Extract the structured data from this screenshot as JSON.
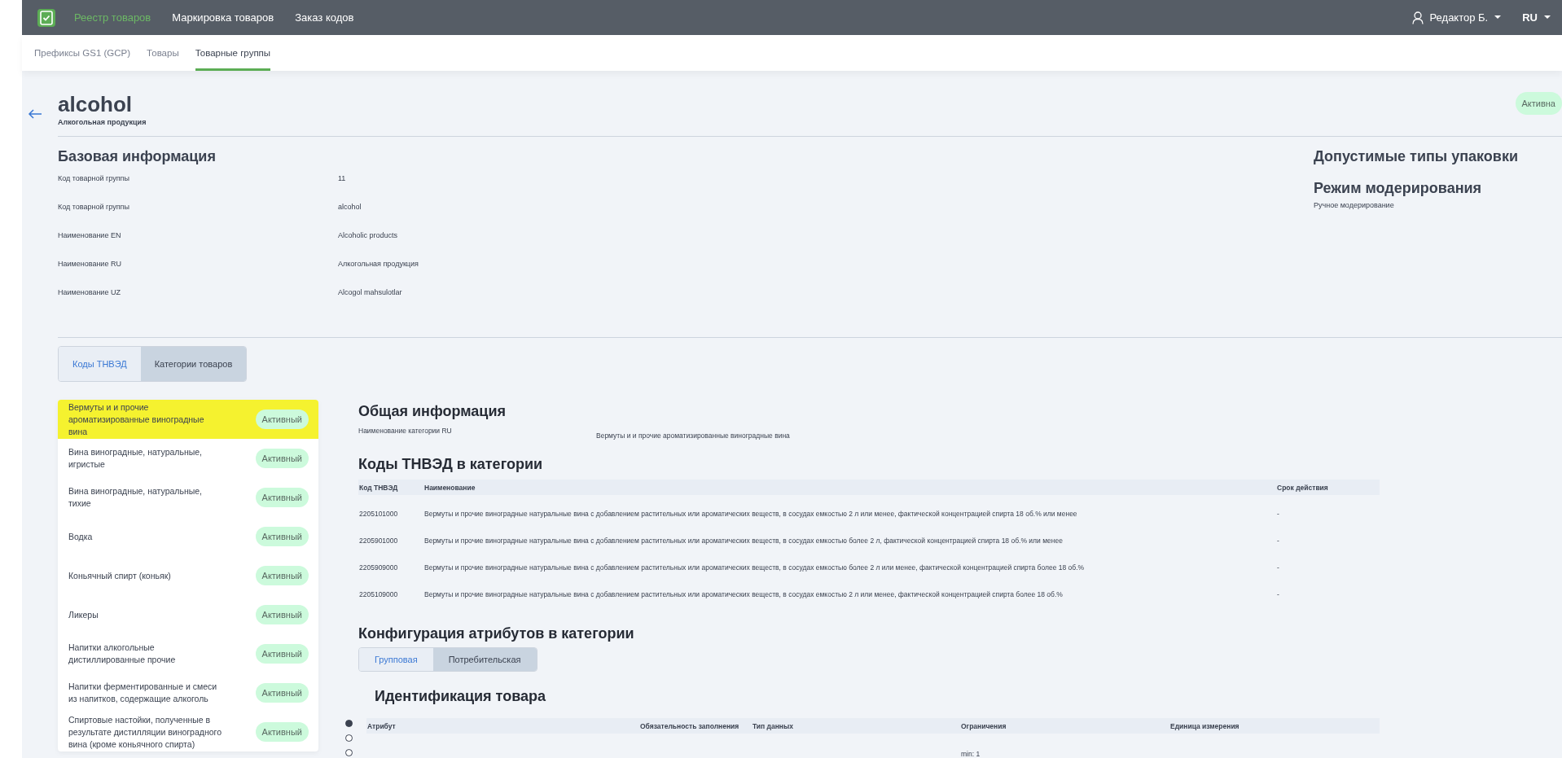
{
  "nav": {
    "items": [
      {
        "label": "Реестр товаров",
        "selected": true
      },
      {
        "label": "Маркировка товаров",
        "selected": false
      },
      {
        "label": "Заказ кодов",
        "selected": false
      }
    ],
    "user": "Редактор Б.",
    "language": "RU"
  },
  "subtabs": [
    {
      "label": "Префиксы GS1 (GCP)",
      "selected": false
    },
    {
      "label": "Товары",
      "selected": false
    },
    {
      "label": "Товарные группы",
      "selected": true
    }
  ],
  "header": {
    "title": "alcohol",
    "subtitle": "Алкогольная продукция",
    "status": "Активна"
  },
  "basic_info": {
    "title": "Базовая информация",
    "rows": [
      {
        "label": "Код товарной группы",
        "value": "11"
      },
      {
        "label": "Код товарной группы",
        "value": "alcohol"
      },
      {
        "label": "Наименование EN",
        "value": "Alcoholic products"
      },
      {
        "label": "Наименование RU",
        "value": "Алкогольная продукция"
      },
      {
        "label": "Наименование UZ",
        "value": "Alcogol mahsulotlar"
      }
    ]
  },
  "side_info": [
    {
      "title": "Допустимые типы упаковки"
    },
    {
      "title": "Режим модерирования",
      "value": "Ручное модерирование"
    }
  ],
  "view_tabs": [
    {
      "label": "Коды ТНВЭД",
      "selected": false
    },
    {
      "label": "Категории товаров",
      "selected": true
    }
  ],
  "categories": [
    {
      "name": "Вермуты и и прочие ароматизированные виноградные вина",
      "status": "Активный",
      "selected": true
    },
    {
      "name": "Вина виноградные, натуральные, игристые",
      "status": "Активный",
      "selected": false
    },
    {
      "name": "Вина виноградные, натуральные, тихие",
      "status": "Активный",
      "selected": false
    },
    {
      "name": "Водка",
      "status": "Активный",
      "selected": false
    },
    {
      "name": "Коньячный спирт (коньяк)",
      "status": "Активный",
      "selected": false
    },
    {
      "name": "Ликеры",
      "status": "Активный",
      "selected": false
    },
    {
      "name": "Напитки алкогольные дистиллированные прочие",
      "status": "Активный",
      "selected": false
    },
    {
      "name": "Напитки ферментированные и смеси из напитков, содержащие алкоголь",
      "status": "Активный",
      "selected": false
    },
    {
      "name": "Спиртовые настойки, полученные в результате дистилляции виноградного вина (кроме коньячного спирта)",
      "status": "Активный",
      "selected": false
    }
  ],
  "general": {
    "title": "Общая информация",
    "label": "Наименование категории RU",
    "value": "Вермуты и и прочие ароматизированные виноградные вина"
  },
  "codes": {
    "title": "Коды ТНВЭД в категории",
    "columns": [
      "Код ТНВЭД",
      "Наименование",
      "Срок действия"
    ],
    "rows": [
      [
        "2205101000",
        "Вермуты и прочие виноградные натуральные вина с добавлением растительных или ароматических веществ, в сосудах емкостью 2 л или менее, фактической концентрацией спирта 18 об.% или менее",
        "-"
      ],
      [
        "2205901000",
        "Вермуты и прочие виноградные натуральные вина с добавлением растительных или ароматических веществ, в сосудах емкостью более 2 л, фактической концентрацией спирта 18 об.% или менее",
        "-"
      ],
      [
        "2205909000",
        "Вермуты и прочие виноградные натуральные вина с добавлением растительных или ароматических веществ, в сосудах емкостью более 2 л или менее, фактической концентрацией спирта более 18 об.%",
        "-"
      ],
      [
        "2205109000",
        "Вермуты и прочие виноградные натуральные вина с добавлением растительных или ароматических веществ, в сосудах емкостью 2 л или менее, фактической концентрацией спирта более 18 об.%",
        "-"
      ]
    ]
  },
  "attributes": {
    "title": "Конфигурация атрибутов в категории",
    "tabs": [
      {
        "label": "Групповая",
        "selected": false
      },
      {
        "label": "Потребительская",
        "selected": true
      }
    ],
    "section_title": "Идентификация товара",
    "pager": [
      {
        "selected": true
      },
      {
        "selected": false
      },
      {
        "selected": false
      }
    ],
    "columns": [
      "Атрибут",
      "Обязательность заполнения",
      "Тип данных",
      "Ограничения",
      "Единица измерения"
    ],
    "rows": [
      {
        "limits": "min: 1"
      }
    ]
  }
}
